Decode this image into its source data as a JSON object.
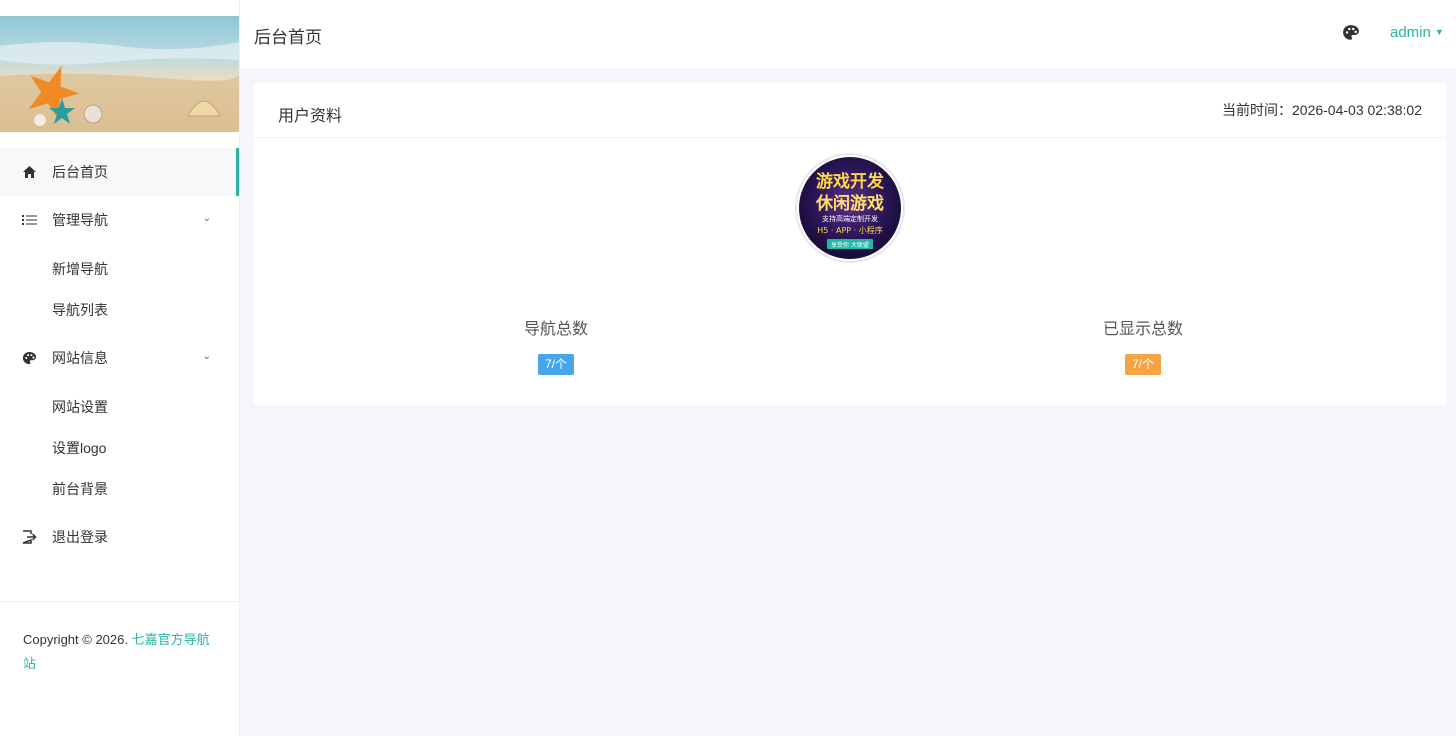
{
  "sidebar": {
    "menu": {
      "home": "后台首页",
      "nav_manage": "管理导航",
      "nav_add": "新增导航",
      "nav_list": "导航列表",
      "site_info": "网站信息",
      "site_settings": "网站设置",
      "set_logo": "设置logo",
      "front_bg": "前台背景",
      "logout": "退出登录"
    },
    "footer": {
      "copyright": "Copyright © 2026. ",
      "brand": "七嘉官方导航站"
    }
  },
  "header": {
    "title": "后台首页",
    "user": "admin"
  },
  "card": {
    "title": "用户资料",
    "time_label": "当前时间：",
    "time_value": "2026-04-03 02:38:02",
    "avatar": {
      "line1": "游戏开发",
      "line2": "休闲游戏",
      "line3": "支持高端定制开发",
      "line4": "H5 · APP · 小程序",
      "line5": "享受你 大联盟"
    },
    "stats": [
      {
        "label": "导航总数",
        "value": "7/个",
        "color": "#46a6ec"
      },
      {
        "label": "已显示总数",
        "value": "7/个",
        "color": "#f7a343"
      }
    ]
  },
  "colors": {
    "accent": "#26b6a1"
  }
}
